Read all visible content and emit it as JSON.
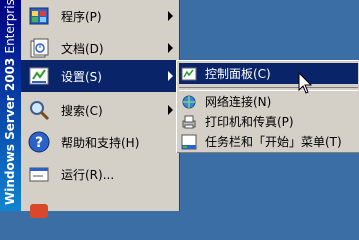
{
  "banner": {
    "title": "Windows Server 2003",
    "edition": "Enterprise Edition"
  },
  "start_menu": {
    "items": [
      {
        "label": "程序(P)",
        "icon": "programs-icon",
        "has_submenu": true
      },
      {
        "label": "文档(D)",
        "icon": "documents-icon",
        "has_submenu": true
      },
      {
        "label": "设置(S)",
        "icon": "settings-icon",
        "has_submenu": true,
        "selected": true
      },
      {
        "label": "搜索(C)",
        "icon": "search-icon",
        "has_submenu": true
      },
      {
        "label": "帮助和支持(H)",
        "icon": "help-icon",
        "has_submenu": false
      },
      {
        "label": "运行(R)...",
        "icon": "run-icon",
        "has_submenu": false
      }
    ]
  },
  "submenu": {
    "items": [
      {
        "label": "控制面板(C)",
        "icon": "control-panel-icon",
        "selected": true
      },
      {
        "label": "网络连接(N)",
        "icon": "network-connections-icon"
      },
      {
        "label": "打印机和传真(P)",
        "icon": "printers-faxes-icon"
      },
      {
        "label": "任务栏和「开始」菜单(T)",
        "icon": "taskbar-start-menu-icon"
      }
    ]
  },
  "colors": {
    "highlight": "#0a246a",
    "menu_bg": "#d4d0c8",
    "desktop": "#3a6ea5"
  }
}
